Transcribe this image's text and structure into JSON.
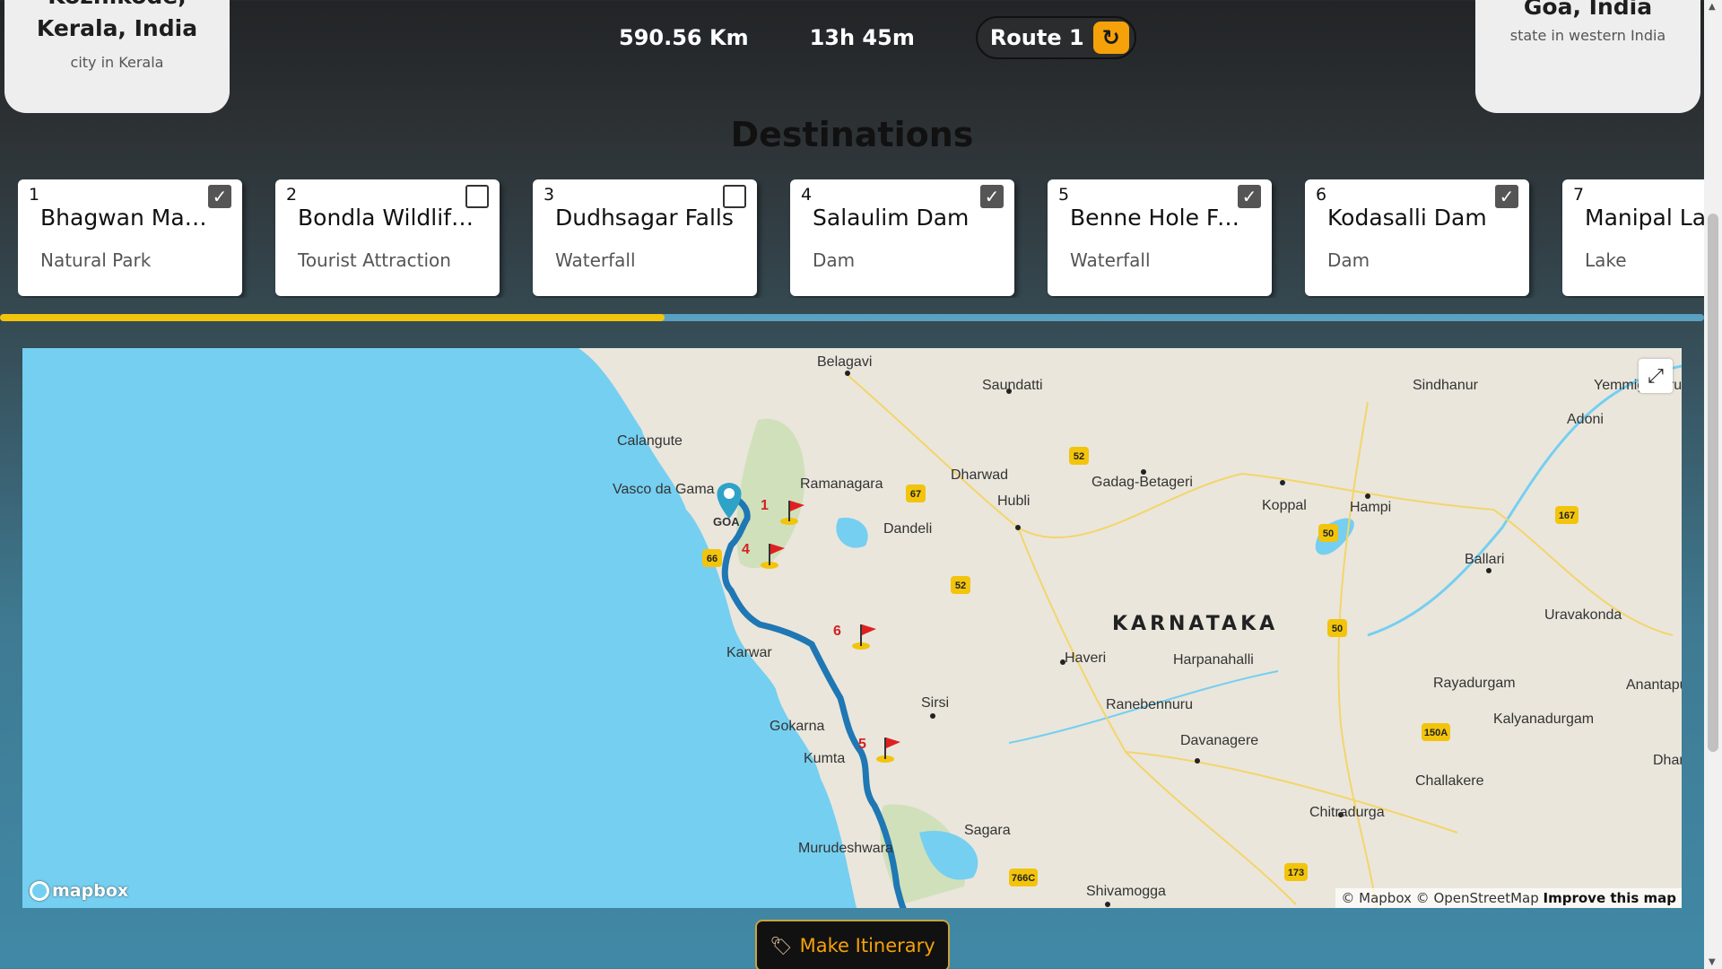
{
  "origin": {
    "title": "Kozhikode, Kerala, India",
    "subtitle": "city in Kerala"
  },
  "destination_end": {
    "title": "Goa, India",
    "subtitle": "state in western India"
  },
  "stats": {
    "distance": "590.56 Km",
    "duration": "13h 45m"
  },
  "route": {
    "label": "Route 1",
    "refresh_icon": "refresh-icon"
  },
  "destinations": {
    "heading": "Destinations",
    "progress_fraction": 0.39,
    "items": [
      {
        "number": "1",
        "name": "Bhagwan Mahaveer Sanctuary",
        "category": "Natural Park",
        "checked": true
      },
      {
        "number": "2",
        "name": "Bondla Wildlife Sanctuary",
        "category": "Tourist Attraction",
        "checked": false
      },
      {
        "number": "3",
        "name": "Dudhsagar Falls",
        "category": "Waterfall",
        "checked": false
      },
      {
        "number": "4",
        "name": "Salaulim Dam",
        "category": "Dam",
        "checked": true
      },
      {
        "number": "5",
        "name": "Benne Hole Falls",
        "category": "Waterfall",
        "checked": true
      },
      {
        "number": "6",
        "name": "Kodasalli Dam",
        "category": "Dam",
        "checked": true
      },
      {
        "number": "7",
        "name": "Manipal Lake",
        "category": "Lake",
        "checked": false
      }
    ]
  },
  "map": {
    "region_label": "KARNATAKA",
    "places": [
      "Belagavi",
      "Saundatti",
      "Sindhanur",
      "Yemmiganuru",
      "Calangute",
      "Vasco da Gama",
      "Adoni",
      "Ramanagara",
      "Dharwad",
      "Gadag-Betageri",
      "Koppal",
      "Hampi",
      "Hubli",
      "Dandeli",
      "Ballari",
      "Haveri",
      "Uravakonda",
      "Harpanahalli",
      "Karwar",
      "Rayadurgam",
      "Anantapur",
      "Sirsi",
      "Ranebennuru",
      "Kalyanadurgam",
      "Gokarna",
      "Davanagere",
      "Kumta",
      "Challakere",
      "Sagara",
      "Chitradurga",
      "Murudeshwara",
      "Shivamogga",
      "GOA",
      "Dharmavaram"
    ],
    "highways": [
      "52",
      "67",
      "50",
      "167",
      "66",
      "52",
      "50",
      "150A",
      "766C",
      "173"
    ],
    "markers": [
      "1",
      "4",
      "6",
      "5"
    ],
    "attribution": "© Mapbox © OpenStreetMap",
    "improve": "Improve this map",
    "logo": "mapbox",
    "fullscreen_icon": "fullscreen-icon"
  },
  "itinerary_button": {
    "label": "Make Itinerary",
    "icon": "tag-icon"
  },
  "colors": {
    "accent": "#f5a10a",
    "progress": "#f2c40c",
    "route_line": "#1f77b4",
    "water": "#75cff0"
  }
}
